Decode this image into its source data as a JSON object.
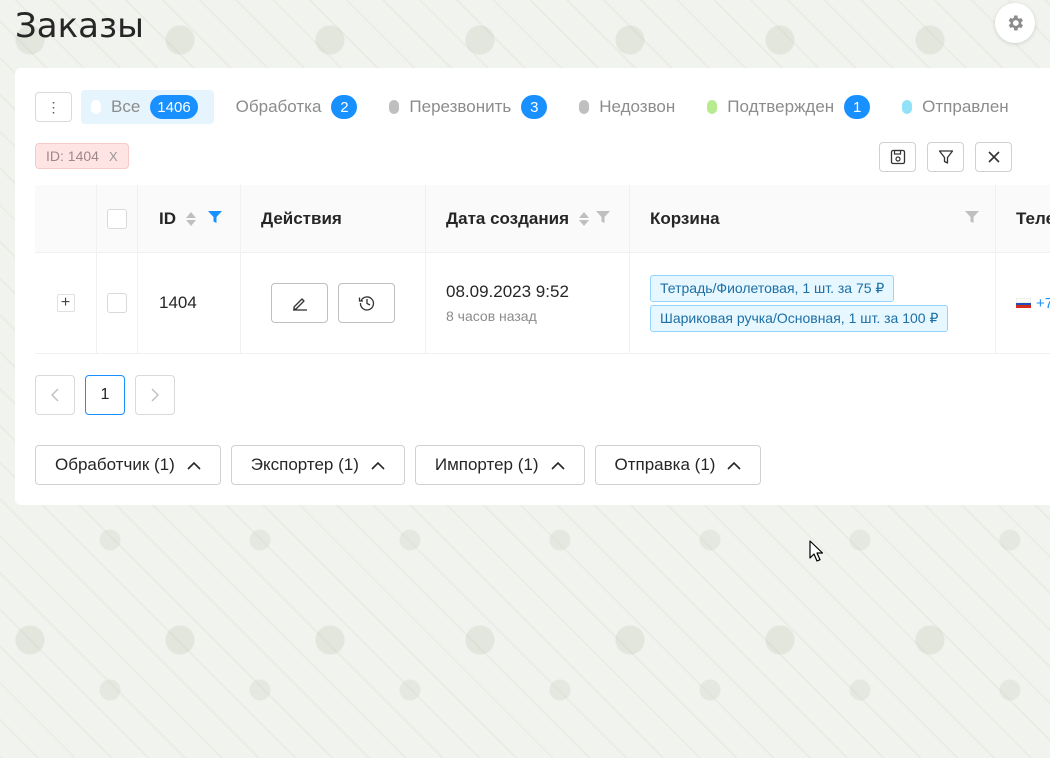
{
  "page": {
    "title": "Заказы"
  },
  "tabs": [
    {
      "label": "Все",
      "count": "1406",
      "dot_color": "#ffffff",
      "active": true
    },
    {
      "label": "Обработка",
      "count": "2",
      "dot_color": "",
      "active": false
    },
    {
      "label": "Перезвонить",
      "count": "3",
      "dot_color": "#bfbfbf",
      "active": false
    },
    {
      "label": "Недозвон",
      "count": "",
      "dot_color": "#bfbfbf",
      "active": false
    },
    {
      "label": "Подтвержден",
      "count": "1",
      "dot_color": "#b7eb8f",
      "active": false
    },
    {
      "label": "Отправлен",
      "count": "",
      "dot_color": "#91e2f7",
      "active": false
    }
  ],
  "filter_chip": {
    "label": "ID: 1404",
    "remove": "X"
  },
  "table": {
    "headers": {
      "id": "ID",
      "actions": "Действия",
      "created": "Дата создания",
      "cart": "Корзина",
      "phone": "Теле"
    },
    "rows": [
      {
        "id": "1404",
        "date": "08.09.2023 9:52",
        "relative": "8 часов назад",
        "cart": [
          "Тетрадь/Фиолетовая, 1 шт. за 75 ₽",
          "Шариковая ручка/Основная, 1 шт. за 100 ₽"
        ],
        "phone": "+7"
      }
    ]
  },
  "pagination": {
    "prev": "<",
    "current": "1",
    "next": ">"
  },
  "bottom_buttons": [
    {
      "label": "Обработчик (1)"
    },
    {
      "label": "Экспортер (1)"
    },
    {
      "label": "Импортер (1)"
    },
    {
      "label": "Отправка (1)"
    }
  ],
  "colors": {
    "accent": "#1890ff",
    "chip_bg": "#ffe4e4",
    "tag_bg": "#e6f7ff"
  }
}
